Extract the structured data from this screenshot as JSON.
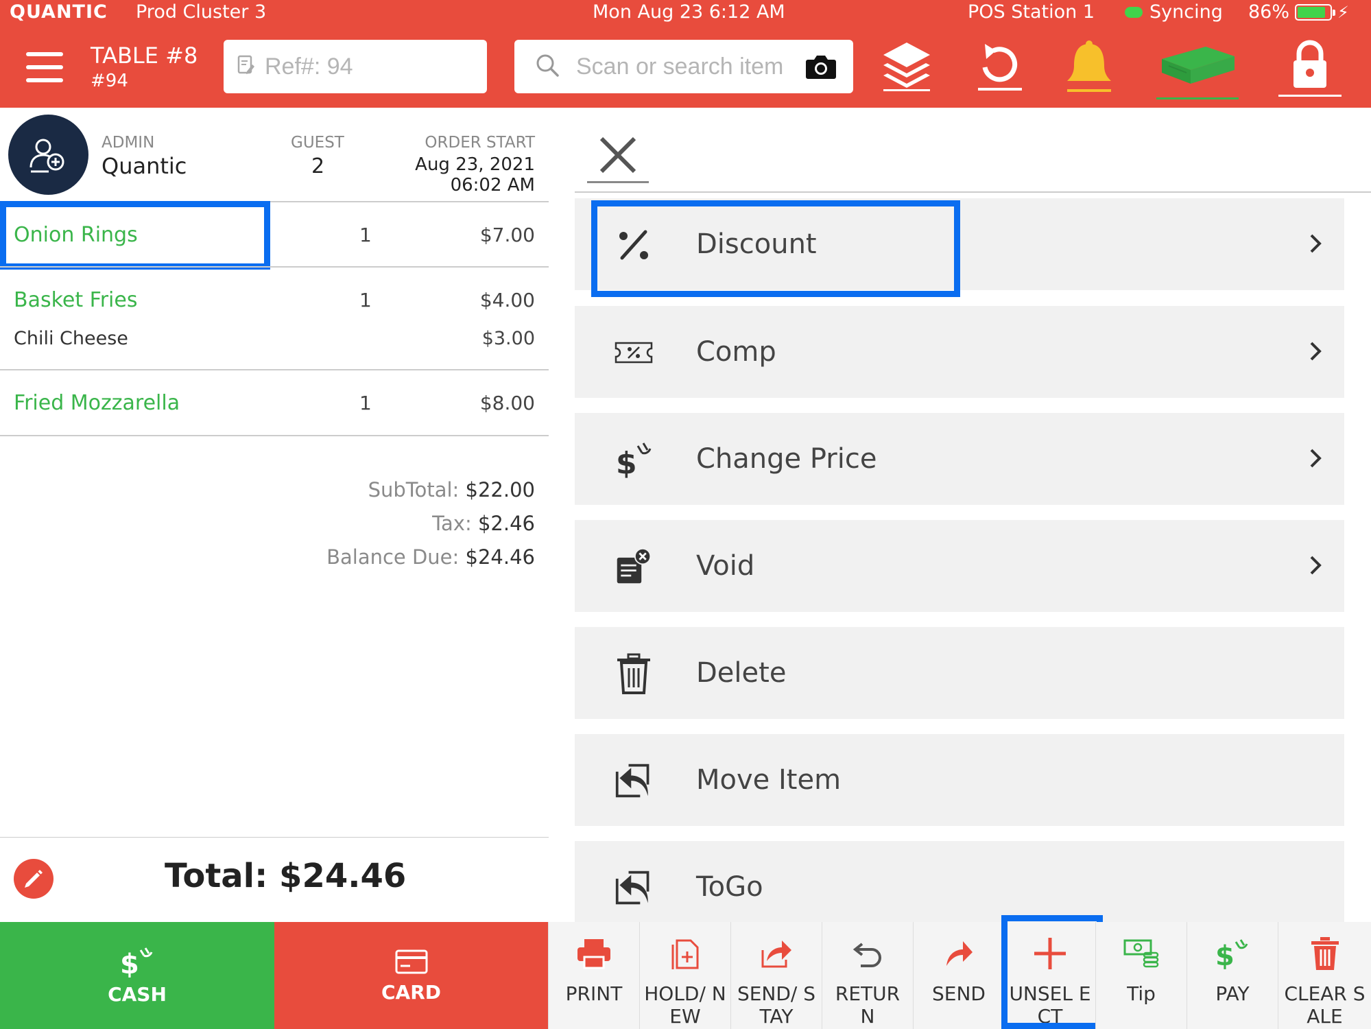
{
  "status_bar": {
    "brand": "QUANTIC",
    "cluster": "Prod Cluster 3",
    "datetime": "Mon Aug 23 6:12 AM",
    "station": "POS Station 1",
    "sync": "Syncing",
    "battery": "86%",
    "battery_level": 0.86
  },
  "top_bar": {
    "table_title": "TABLE #8",
    "table_sub": "#94",
    "ref_placeholder": "Ref#: 94",
    "search_placeholder": "Scan or search item",
    "icons": [
      "menu-icon",
      "ref-note-icon",
      "search-icon",
      "camera-icon",
      "layers-icon",
      "refresh-icon",
      "bell-icon",
      "cash-drawer-icon",
      "lock-icon"
    ]
  },
  "order_header": {
    "role": "ADMIN",
    "name": "Quantic",
    "guest_label": "GUEST",
    "guest_count": "2",
    "order_start_label": "ORDER START",
    "order_start_date": "Aug 23, 2021",
    "order_start_time": "06:02 AM"
  },
  "order_items": [
    {
      "name": "Onion Rings",
      "qty": "1",
      "price": "$7.00",
      "modifiers": []
    },
    {
      "name": "Basket Fries",
      "qty": "1",
      "price": "$4.00",
      "modifiers": [
        {
          "name": "Chili Cheese",
          "price": "$3.00"
        }
      ]
    },
    {
      "name": "Fried Mozzarella",
      "qty": "1",
      "price": "$8.00",
      "modifiers": []
    }
  ],
  "totals": {
    "subtotal_label": "SubTotal:",
    "subtotal": "$22.00",
    "tax_label": "Tax:",
    "tax": "$2.46",
    "balance_label": "Balance Due:",
    "balance": "$24.46",
    "total": "Total: $24.46"
  },
  "actions": [
    {
      "label": "Discount",
      "icon": "percent-icon",
      "chevron": true
    },
    {
      "label": "Comp",
      "icon": "coupon-icon",
      "chevron": true
    },
    {
      "label": "Change Price",
      "icon": "dollar-change-icon",
      "chevron": true
    },
    {
      "label": "Void",
      "icon": "void-receipt-icon",
      "chevron": true
    },
    {
      "label": "Delete",
      "icon": "trash-icon",
      "chevron": false
    },
    {
      "label": "Move Item",
      "icon": "move-item-icon",
      "chevron": false
    },
    {
      "label": "ToGo",
      "icon": "togo-icon",
      "chevron": false
    }
  ],
  "bottom_bar": {
    "cash": "CASH",
    "card": "CARD",
    "buttons": [
      {
        "label": "PRINT",
        "icon": "printer-icon"
      },
      {
        "label": "HOLD/ NEW",
        "icon": "hold-new-icon"
      },
      {
        "label": "SEND/ STAY",
        "icon": "send-stay-icon"
      },
      {
        "label": "RETUR N",
        "icon": "return-icon"
      },
      {
        "label": "SEND",
        "icon": "send-icon"
      },
      {
        "label": "UNSEL ECT",
        "icon": "plus-icon"
      },
      {
        "label": "Tip",
        "icon": "tip-icon"
      },
      {
        "label": "PAY",
        "icon": "pay-icon"
      },
      {
        "label": "CLEAR SALE",
        "icon": "clear-sale-icon"
      }
    ]
  },
  "colors": {
    "brand_red": "#e84c3d",
    "green": "#3ab54a",
    "highlight_blue": "#0a6df0",
    "avatar_navy": "#1a2a44"
  }
}
